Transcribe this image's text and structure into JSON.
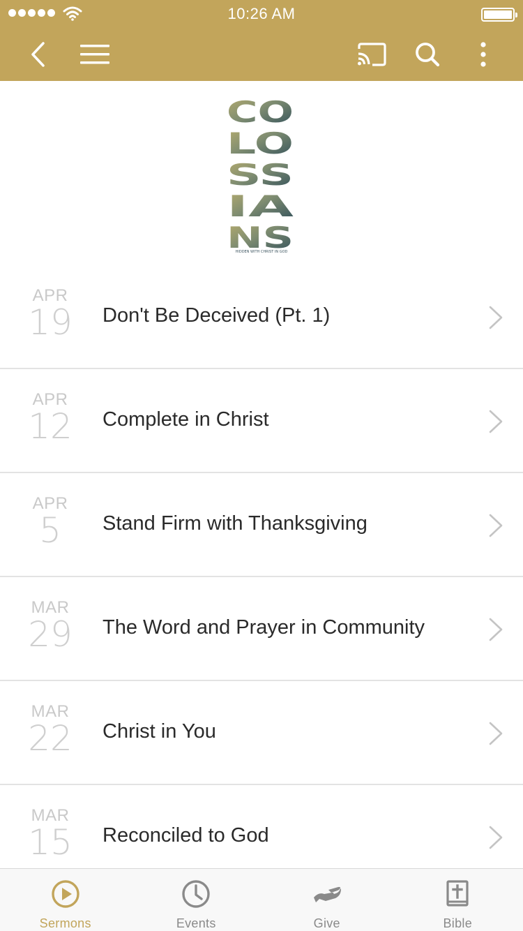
{
  "status_bar": {
    "time": "10:26 AM"
  },
  "nav": {
    "icons": [
      "back-icon",
      "menu-icon",
      "cast-icon",
      "search-icon",
      "more-vertical-icon"
    ]
  },
  "banner": {
    "logo_lines": [
      "CO",
      "LO",
      "SS",
      "IA",
      "NS"
    ],
    "logo_tagline": "HIDDEN WITH CHRIST IN GOD"
  },
  "sermons": [
    {
      "month": "APR",
      "day": "19",
      "title": "Don't Be Deceived (Pt. 1)"
    },
    {
      "month": "APR",
      "day": "12",
      "title": "Complete in Christ"
    },
    {
      "month": "APR",
      "day": "5",
      "title": "Stand Firm with Thanksgiving"
    },
    {
      "month": "MAR",
      "day": "29",
      "title": "The Word and Prayer in Community"
    },
    {
      "month": "MAR",
      "day": "22",
      "title": "Christ in You"
    },
    {
      "month": "MAR",
      "day": "15",
      "title": "Reconciled to God"
    }
  ],
  "tabs": [
    {
      "label": "Sermons",
      "icon": "play-circle-icon",
      "active": true
    },
    {
      "label": "Events",
      "icon": "clock-icon",
      "active": false
    },
    {
      "label": "Give",
      "icon": "give-hand-icon",
      "active": false
    },
    {
      "label": "Bible",
      "icon": "bible-icon",
      "active": false
    }
  ],
  "colors": {
    "accent": "#c2a55b",
    "tab_inactive": "#8a8a8a",
    "date_text": "#c9c9c9",
    "divider": "#e3e3e3"
  }
}
